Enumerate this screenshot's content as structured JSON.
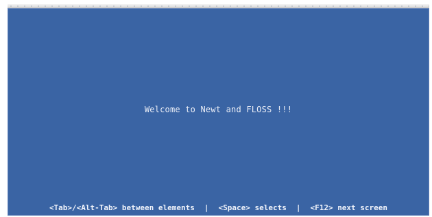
{
  "screen": {
    "welcome_text": "Welcome to Newt and FLOSS !!!"
  },
  "help_line": {
    "items": [
      "<Tab>/<Alt-Tab> between elements",
      "<Space> selects",
      "<F12> next screen"
    ],
    "separator": "|"
  },
  "colors": {
    "background": "#3a64a4",
    "text": "#e9edf6"
  }
}
